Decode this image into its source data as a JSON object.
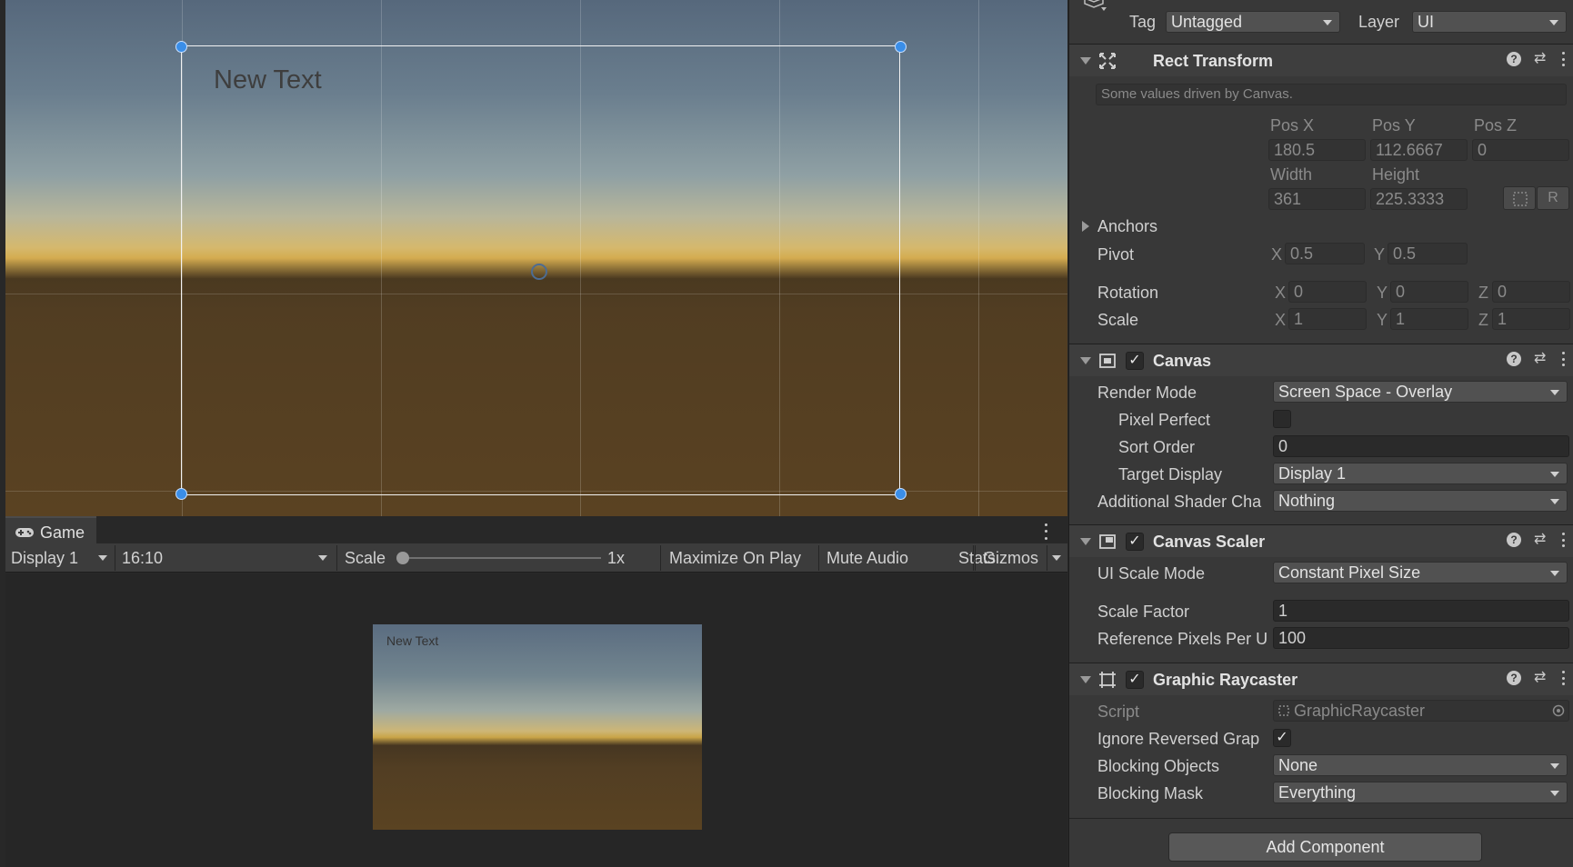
{
  "scene": {
    "text_label": "New Text"
  },
  "game": {
    "tab_label": "Game",
    "display": "Display 1",
    "aspect": "16:10",
    "scale_label": "Scale",
    "scale_value": "1x",
    "scale_slider_fraction": 0.0,
    "maximize_on_play": "Maximize On Play",
    "mute_audio": "Mute Audio",
    "stats": "Stats",
    "gizmos": "Gizmos",
    "render_text": "New Text"
  },
  "inspector": {
    "tag_label": "Tag",
    "tag_value": "Untagged",
    "layer_label": "Layer",
    "layer_value": "UI",
    "rect_transform": {
      "title": "Rect Transform",
      "note": "Some values driven by Canvas.",
      "pos_x_label": "Pos X",
      "pos_y_label": "Pos Y",
      "pos_z_label": "Pos Z",
      "pos_x": "180.5",
      "pos_y": "112.6667",
      "pos_z": "0",
      "width_label": "Width",
      "height_label": "Height",
      "width": "361",
      "height": "225.3333",
      "raw_button": "R",
      "anchors_label": "Anchors",
      "pivot_label": "Pivot",
      "pivot_x": "0.5",
      "pivot_y": "0.5",
      "rotation_label": "Rotation",
      "rot_x": "0",
      "rot_y": "0",
      "rot_z": "0",
      "scale_label": "Scale",
      "scale_x": "1",
      "scale_y": "1",
      "scale_z": "1",
      "axis_x": "X",
      "axis_y": "Y",
      "axis_z": "Z"
    },
    "canvas": {
      "title": "Canvas",
      "enabled": true,
      "render_mode_label": "Render Mode",
      "render_mode": "Screen Space - Overlay",
      "pixel_perfect_label": "Pixel Perfect",
      "pixel_perfect": false,
      "sort_order_label": "Sort Order",
      "sort_order": "0",
      "target_display_label": "Target Display",
      "target_display": "Display 1",
      "additional_shader_label": "Additional Shader Cha",
      "additional_shader": "Nothing"
    },
    "canvas_scaler": {
      "title": "Canvas Scaler",
      "enabled": true,
      "ui_scale_mode_label": "UI Scale Mode",
      "ui_scale_mode": "Constant Pixel Size",
      "scale_factor_label": "Scale Factor",
      "scale_factor": "1",
      "ref_pixels_label": "Reference Pixels Per U",
      "ref_pixels": "100"
    },
    "graphic_raycaster": {
      "title": "Graphic Raycaster",
      "enabled": true,
      "script_label": "Script",
      "script_value": "GraphicRaycaster",
      "ignore_reversed_label": "Ignore Reversed Grap",
      "ignore_reversed": true,
      "blocking_objects_label": "Blocking Objects",
      "blocking_objects": "None",
      "blocking_mask_label": "Blocking Mask",
      "blocking_mask": "Everything"
    },
    "add_component": "Add Component",
    "help_glyph": "?",
    "check_glyph": "✓"
  },
  "colors": {
    "handle": "#3a8ee8",
    "panel": "#383838",
    "field": "#2a2a2a",
    "dropdown": "#515151"
  }
}
